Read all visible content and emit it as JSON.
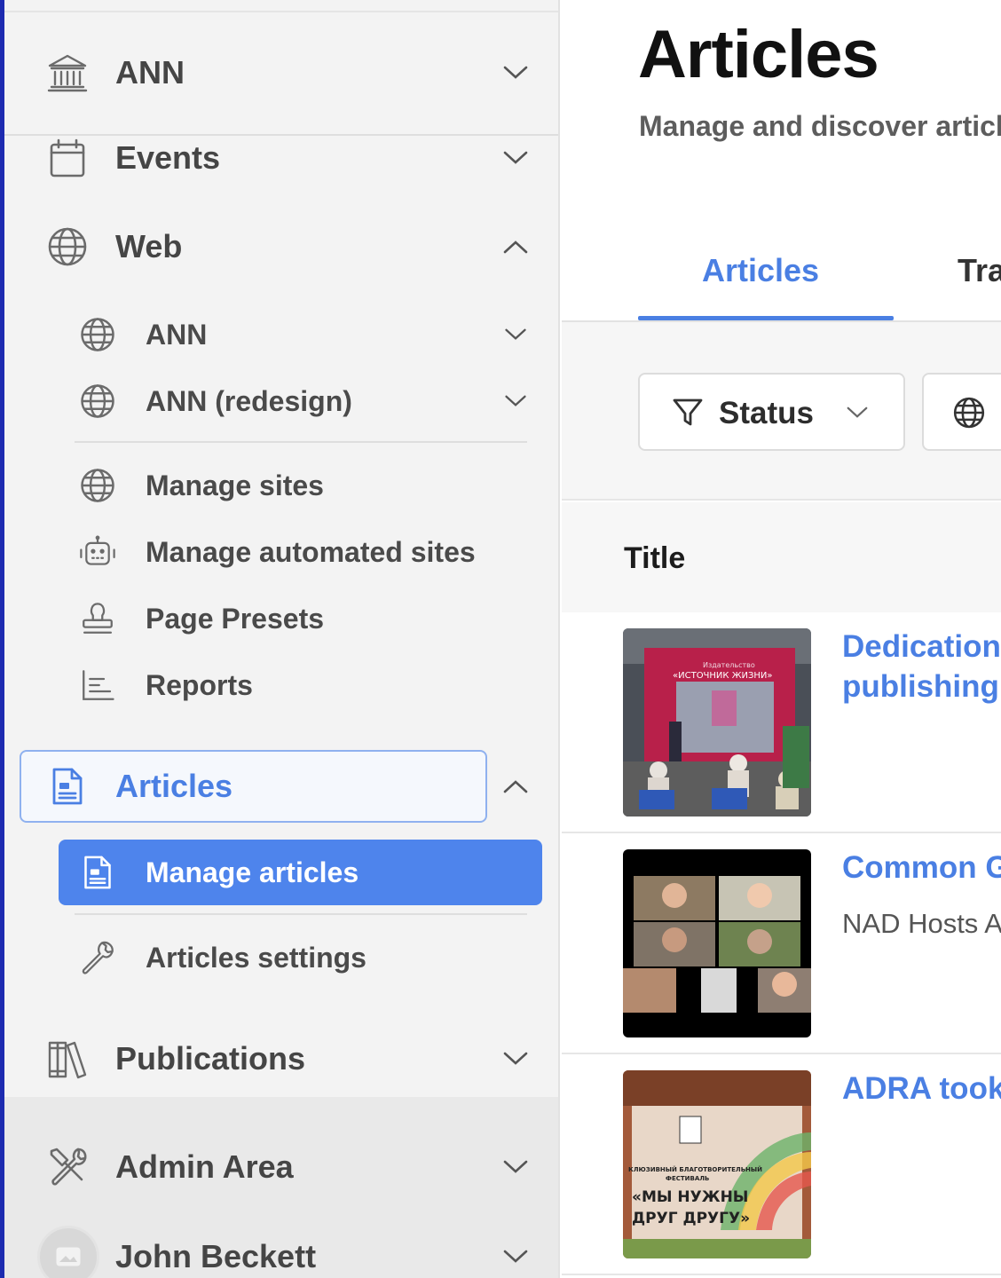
{
  "sidebar": {
    "ann_label": "ANN",
    "events_label": "Events",
    "web_label": "Web",
    "web_children": {
      "ann_label": "ANN",
      "ann_redesign_label": "ANN (redesign)",
      "manage_sites_label": "Manage sites",
      "manage_automated_label": "Manage automated sites",
      "page_presets_label": "Page Presets",
      "reports_label": "Reports"
    },
    "articles_label": "Articles",
    "articles_children": {
      "manage_articles_label": "Manage articles",
      "articles_settings_label": "Articles settings"
    },
    "publications_label": "Publications",
    "admin_area_label": "Admin Area",
    "user_name": "John Beckett"
  },
  "main": {
    "title": "Articles",
    "subtitle": "Manage and discover articl",
    "tabs": [
      {
        "label": "Articles"
      },
      {
        "label": "Tra"
      }
    ],
    "filters": {
      "status_label": "Status"
    },
    "table": {
      "title_header": "Title",
      "rows": [
        {
          "title_line1": "Dedication",
          "title_line2": "publishing",
          "thumb_caption_1": "Издательство",
          "thumb_caption_2": "«ИСТОЧНИК ЖИЗНИ»"
        },
        {
          "title_line1": "Common G",
          "subtitle": "NAD Hosts A"
        },
        {
          "title_line1": "ADRA took",
          "thumb_caption_1": "КЛЮЗИВНЫЙ БЛАГОТВОРИТЕЛЬНЫЙ",
          "thumb_caption_2": "ФЕСТИВАЛЬ",
          "thumb_caption_3": "«МЫ НУЖНЫ",
          "thumb_caption_4": "ДРУГ ДРУГУ»"
        }
      ]
    }
  },
  "colors": {
    "accent": "#4a7fe3",
    "active_bg": "#4e84ec",
    "sidebar_bg": "#f3f3f3"
  }
}
